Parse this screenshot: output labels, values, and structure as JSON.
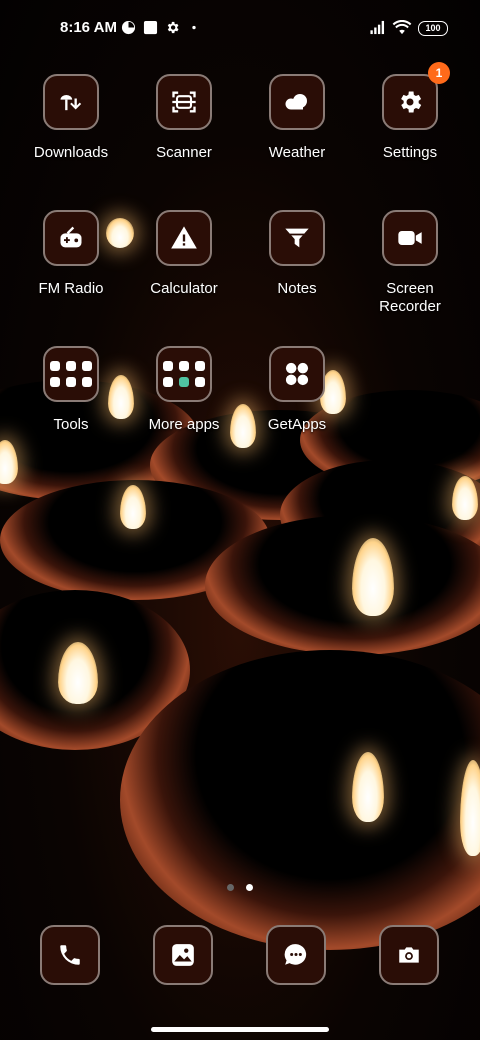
{
  "status_bar": {
    "time": "8:16 AM",
    "battery": "100",
    "icons": [
      "data-saver-icon",
      "notification-square-icon",
      "gear-icon",
      "dot-icon",
      "signal-icon",
      "wifi-icon",
      "battery-icon"
    ]
  },
  "apps": [
    {
      "label": "Downloads",
      "icon": "downloads-icon"
    },
    {
      "label": "Scanner",
      "icon": "scanner-icon"
    },
    {
      "label": "Weather",
      "icon": "weather-icon"
    },
    {
      "label": "Settings",
      "icon": "gear-icon",
      "badge": "1"
    },
    {
      "label": "FM Radio",
      "icon": "radio-icon"
    },
    {
      "label": "Calculator",
      "icon": "warning-icon"
    },
    {
      "label": "Notes",
      "icon": "funnel-icon"
    },
    {
      "label": "Screen Recorder",
      "icon": "video-camera-icon"
    },
    {
      "label": "Tools",
      "icon": "folder-icon"
    },
    {
      "label": "More apps",
      "icon": "folder-icon"
    },
    {
      "label": "GetApps",
      "icon": "four-dots-icon"
    }
  ],
  "dock": [
    {
      "icon": "phone-icon"
    },
    {
      "icon": "gallery-icon"
    },
    {
      "icon": "messages-icon"
    },
    {
      "icon": "camera-icon"
    }
  ],
  "page_indicator": {
    "pages": 2,
    "active": 2
  },
  "colors": {
    "tile_bg": "#2a0d06",
    "tile_border": "#8a7b76",
    "badge": "#ff6a1a"
  }
}
